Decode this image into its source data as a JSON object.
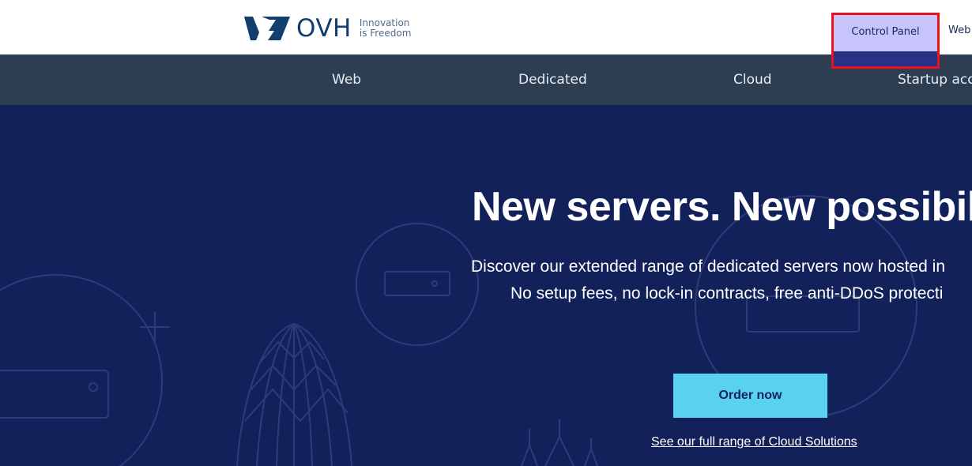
{
  "header": {
    "logo_word": "OVH",
    "tagline_line1": "Innovation",
    "tagline_line2": "is Freedom",
    "control_panel_label": "Control Panel",
    "web_link_label": "Web"
  },
  "nav": {
    "items": [
      {
        "label": "Web"
      },
      {
        "label": "Dedicated"
      },
      {
        "label": "Cloud"
      },
      {
        "label": "Startup accel"
      }
    ]
  },
  "hero": {
    "title": "New servers. New possibiliti",
    "subtitle_line1": "Discover our extended range of dedicated servers now hosted in",
    "subtitle_line2": "No setup fees, no lock-in contracts, free anti-DDoS protecti",
    "order_button": "Order now",
    "cloud_link": "See our full range of Cloud Solutions"
  },
  "colors": {
    "nav_bg": "#2d3e52",
    "hero_bg": "#13215a",
    "accent_button": "#59d2ef",
    "highlight_border": "#e8121c"
  },
  "icons": [
    "ovh-logo-icon"
  ]
}
